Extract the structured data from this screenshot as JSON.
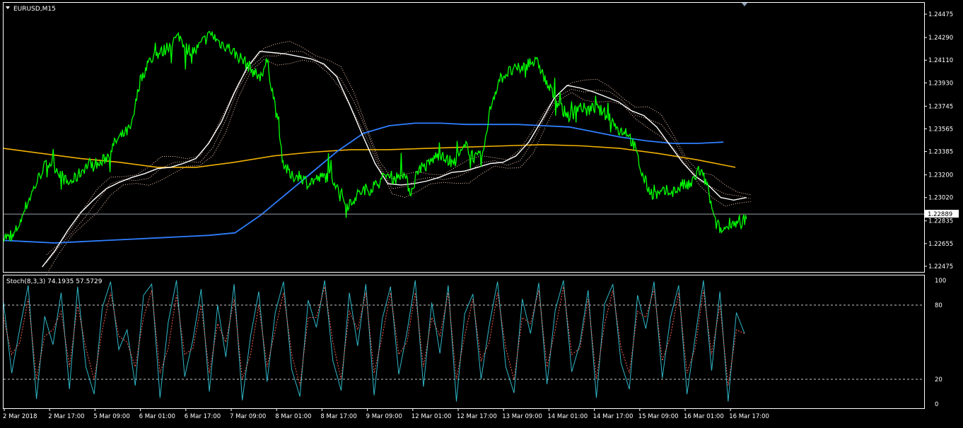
{
  "window": {
    "symbol_title": "EURUSD,M15",
    "indicator_title": "Stoch(8,3,3) 74.1935 57.5729"
  },
  "price_axis": {
    "ticks": [
      "1.24475",
      "1.24290",
      "1.24110",
      "1.23930",
      "1.23745",
      "1.23565",
      "1.23385",
      "1.23200",
      "1.23020",
      "1.22835",
      "1.22655",
      "1.22475"
    ],
    "current_price": "1.22889"
  },
  "stoch_axis": {
    "ticks": [
      "100",
      "80",
      "20",
      "0"
    ]
  },
  "time_axis": {
    "labels": [
      "2 Mar 2018",
      "2 Mar 17:00",
      "5 Mar 09:00",
      "6 Mar 01:00",
      "6 Mar 17:00",
      "7 Mar 09:00",
      "8 Mar 01:00",
      "8 Mar 17:00",
      "9 Mar 09:00",
      "12 Mar 01:00",
      "12 Mar 17:00",
      "13 Mar 09:00",
      "14 Mar 01:00",
      "14 Mar 17:00",
      "15 Mar 09:00",
      "16 Mar 01:00",
      "16 Mar 17:00"
    ]
  },
  "colors": {
    "background": "#000000",
    "axis": "#ffffff",
    "price_line": "#00ff00",
    "ma_white": "#ffffff",
    "ma_blue": "#2f7fff",
    "ma_orange": "#f0b000",
    "dotted_band": "#f4c9b0",
    "stoch_main": "#2fb8c8",
    "stoch_signal": "#ff6050",
    "level_line": "#c8c8c8"
  },
  "chart_data": [
    {
      "type": "line",
      "title": "EURUSD,M15",
      "ylim": [
        1.2243,
        1.24565
      ],
      "x_labels": [
        "2 Mar 2018",
        "2 Mar 17:00",
        "5 Mar 09:00",
        "6 Mar 01:00",
        "6 Mar 17:00",
        "7 Mar 09:00",
        "8 Mar 01:00",
        "8 Mar 17:00",
        "9 Mar 09:00",
        "12 Mar 01:00",
        "12 Mar 17:00",
        "13 Mar 09:00",
        "14 Mar 01:00",
        "14 Mar 17:00",
        "15 Mar 09:00",
        "16 Mar 01:00",
        "16 Mar 17:00"
      ],
      "series": [
        {
          "key": "price",
          "values": [
            1.2272,
            1.2268,
            1.2282,
            1.2298,
            1.2312,
            1.2326,
            1.233,
            1.2322,
            1.2313,
            1.2317,
            1.2325,
            1.233,
            1.2328,
            1.2335,
            1.2346,
            1.2352,
            1.2357,
            1.2392,
            1.2408,
            1.2415,
            1.2418,
            1.2425,
            1.243,
            1.242,
            1.2418,
            1.2426,
            1.2432,
            1.2425,
            1.2422,
            1.2416,
            1.2411,
            1.2404,
            1.2397,
            1.241,
            1.2375,
            1.233,
            1.2318,
            1.232,
            1.2314,
            1.2316,
            1.2318,
            1.232,
            1.2308,
            1.2296,
            1.2302,
            1.2308,
            1.2309,
            1.2314,
            1.232,
            1.2317,
            1.2322,
            1.2306,
            1.2326,
            1.2327,
            1.2334,
            1.2337,
            1.2327,
            1.2335,
            1.2343,
            1.2333,
            1.2335,
            1.2375,
            1.2395,
            1.2401,
            1.2403,
            1.2405,
            1.241,
            1.2408,
            1.2392,
            1.2382,
            1.2371,
            1.2366,
            1.2375,
            1.2371,
            1.2373,
            1.237,
            1.2365,
            1.2355,
            1.2355,
            1.2342,
            1.2319,
            1.2306,
            1.2304,
            1.2307,
            1.2307,
            1.2312,
            1.2311,
            1.2324,
            1.2314,
            1.2283,
            1.2275,
            1.2283,
            1.2281,
            1.2285
          ]
        },
        {
          "key": "ma_white",
          "values": [
            1.2247,
            1.226,
            1.2276,
            1.229,
            1.23,
            1.2309,
            1.2314,
            1.2318,
            1.2321,
            1.2325,
            1.2326,
            1.2329,
            1.2333,
            1.2345,
            1.2362,
            1.2385,
            1.2405,
            1.2418,
            1.2417,
            1.2416,
            1.2414,
            1.2412,
            1.2408,
            1.2398,
            1.2376,
            1.2352,
            1.2329,
            1.2313,
            1.2312,
            1.2313,
            1.2315,
            1.2318,
            1.2322,
            1.2323,
            1.2326,
            1.2329,
            1.233,
            1.2335,
            1.2346,
            1.2363,
            1.2381,
            1.2391,
            1.2389,
            1.2386,
            1.2382,
            1.2378,
            1.2371,
            1.2367,
            1.2358,
            1.2344,
            1.233,
            1.2319,
            1.2312,
            1.2302,
            1.23,
            1.2302
          ]
        },
        {
          "key": "ma_blue",
          "values": [
            1.2268,
            1.2267,
            1.2266,
            1.2267,
            1.2268,
            1.2269,
            1.227,
            1.2271,
            1.2272,
            1.2274,
            1.2288,
            1.2305,
            1.2322,
            1.2339,
            1.2353,
            1.2359,
            1.2361,
            1.2361,
            1.236,
            1.236,
            1.236,
            1.2359,
            1.2358,
            1.2354,
            1.235,
            1.2347,
            1.2345,
            1.2345,
            1.2346
          ]
        },
        {
          "key": "ma_orange",
          "values": [
            1.2341,
            1.2337,
            1.2333,
            1.233,
            1.2326,
            1.2326,
            1.233,
            1.2335,
            1.2338,
            1.234,
            1.234,
            1.2341,
            1.2342,
            1.2343,
            1.2344,
            1.2343,
            1.2341,
            1.2337,
            1.2332,
            1.2326
          ]
        }
      ]
    },
    {
      "type": "line",
      "title": "Stoch(8,3,3) 74.1935 57.5729",
      "ylim": [
        0,
        100
      ],
      "levels": [
        20,
        80
      ],
      "series": [
        {
          "key": "main",
          "values": [
            82,
            25,
            62,
            96,
            4,
            71,
            48,
            90,
            12,
            95,
            30,
            8,
            78,
            99,
            44,
            60,
            15,
            88,
            97,
            5,
            66,
            100,
            22,
            52,
            93,
            10,
            80,
            38,
            97,
            3,
            55,
            91,
            18,
            74,
            99,
            28,
            6,
            84,
            62,
            100,
            35,
            11,
            90,
            47,
            97,
            7,
            69,
            95,
            24,
            58,
            100,
            14,
            82,
            41,
            96,
            2,
            73,
            89,
            20,
            64,
            99,
            30,
            9,
            85,
            57,
            98,
            16,
            76,
            100,
            26,
            49,
            92,
            5,
            81,
            97,
            33,
            12,
            88,
            61,
            99,
            21,
            70,
            96,
            8,
            54,
            100,
            27,
            91,
            2,
            74,
            57
          ]
        },
        {
          "key": "signal",
          "values": [
            70,
            40,
            50,
            85,
            20,
            55,
            60,
            75,
            30,
            80,
            45,
            20,
            60,
            90,
            55,
            50,
            30,
            70,
            92,
            25,
            45,
            88,
            40,
            45,
            80,
            25,
            65,
            50,
            85,
            20,
            40,
            80,
            30,
            60,
            90,
            40,
            15,
            70,
            70,
            95,
            50,
            20,
            75,
            60,
            90,
            25,
            55,
            90,
            40,
            50,
            90,
            30,
            70,
            55,
            90,
            20,
            55,
            85,
            35,
            50,
            90,
            45,
            20,
            70,
            65,
            92,
            30,
            60,
            95,
            40,
            45,
            85,
            20,
            65,
            92,
            45,
            25,
            75,
            70,
            93,
            35,
            55,
            90,
            25,
            45,
            92,
            40,
            80,
            15,
            60,
            57
          ]
        }
      ]
    }
  ]
}
